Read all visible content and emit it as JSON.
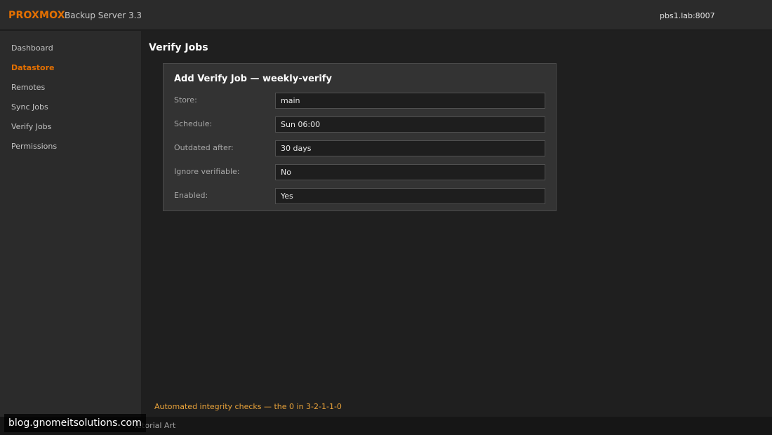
{
  "header": {
    "brand": "PROXMOX",
    "product": "Backup Server 3.3",
    "host": "pbs1.lab:8007"
  },
  "sidebar": {
    "items": [
      {
        "label": "Dashboard",
        "active": false
      },
      {
        "label": "Datastore",
        "active": true
      },
      {
        "label": "Remotes",
        "active": false
      },
      {
        "label": "Sync Jobs",
        "active": false
      },
      {
        "label": "Verify Jobs",
        "active": false
      },
      {
        "label": "Permissions",
        "active": false
      }
    ]
  },
  "main": {
    "title": "Verify Jobs",
    "dialog": {
      "title": "Add Verify Job — weekly-verify",
      "fields": [
        {
          "label": "Store:",
          "value": "main"
        },
        {
          "label": "Schedule:",
          "value": "Sun 06:00"
        },
        {
          "label": "Outdated after:",
          "value": "30 days"
        },
        {
          "label": "Ignore verifiable:",
          "value": "No"
        },
        {
          "label": "Enabled:",
          "value": "Yes"
        }
      ]
    },
    "tagline": "Automated integrity checks — the 0 in 3-2-1-1-0"
  },
  "footer": {
    "text": "Tutorial Art",
    "watermark": "blog.gnomeitsolutions.com"
  },
  "colors": {
    "accent": "#e57000",
    "tagline": "#e8a23a",
    "background": "#1e1e1e",
    "panel": "#2b2b2b"
  }
}
